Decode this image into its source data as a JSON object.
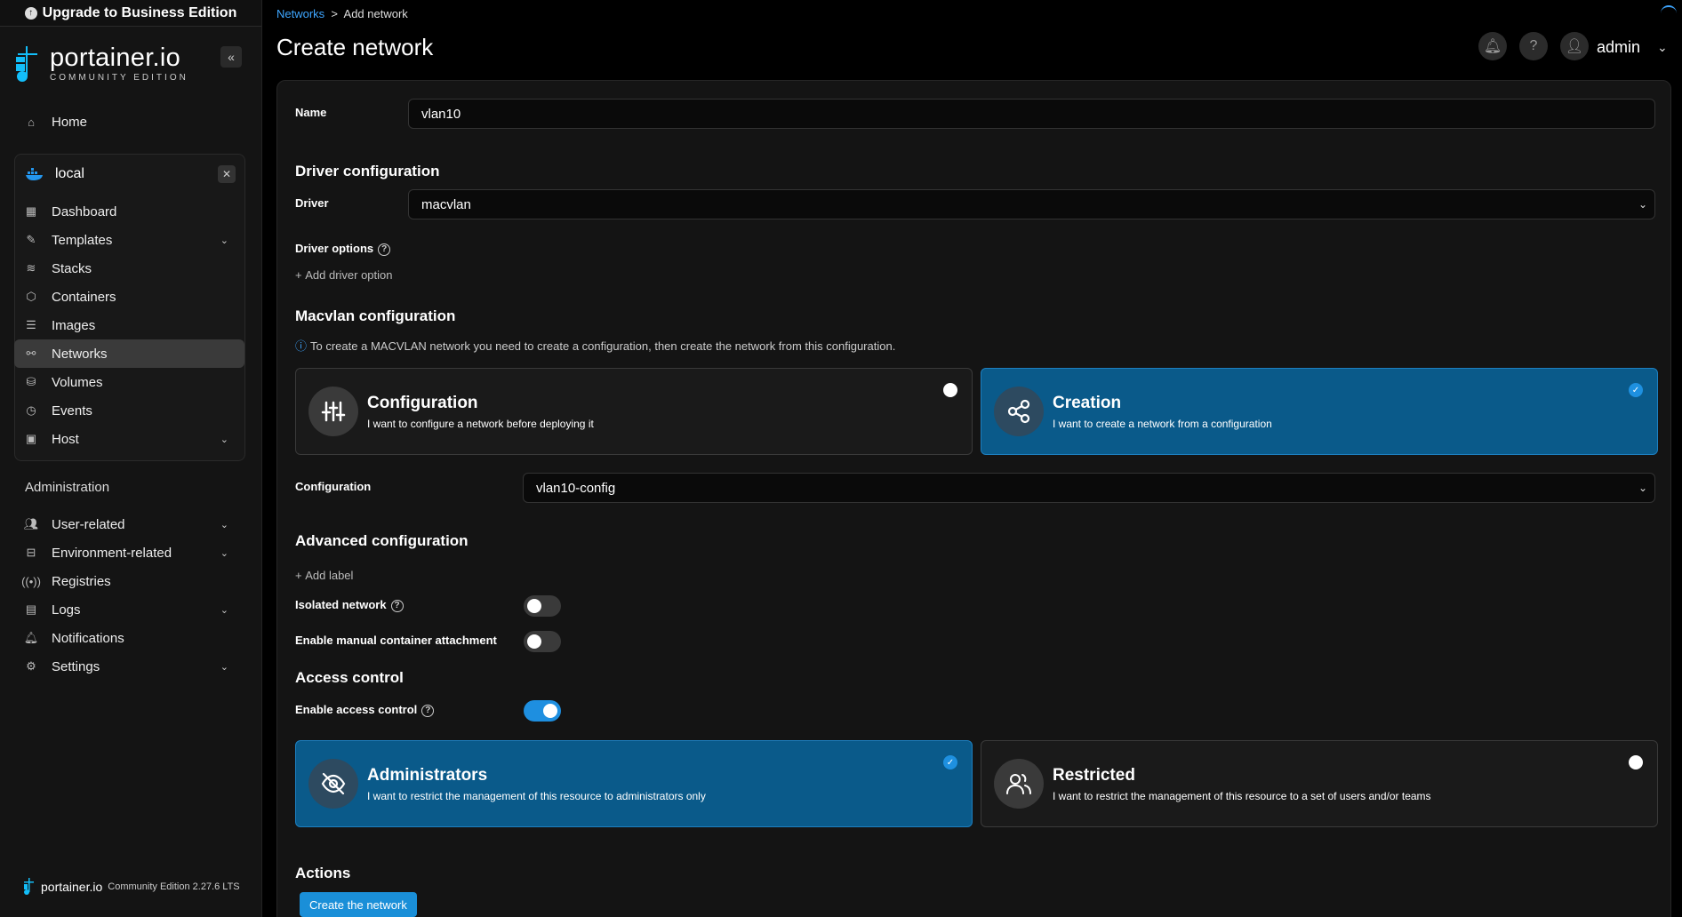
{
  "sidebar": {
    "upgrade_label": "Upgrade to Business Edition",
    "logo_brand": "portainer.io",
    "logo_edition": "COMMUNITY EDITION",
    "home": "Home",
    "environment": {
      "name": "local"
    },
    "env_items": [
      {
        "label": "Dashboard",
        "icon": "dashboard-icon"
      },
      {
        "label": "Templates",
        "icon": "templates-icon"
      },
      {
        "label": "Stacks",
        "icon": "stacks-icon"
      },
      {
        "label": "Containers",
        "icon": "containers-icon"
      },
      {
        "label": "Images",
        "icon": "images-icon"
      },
      {
        "label": "Networks",
        "icon": "networks-icon"
      },
      {
        "label": "Volumes",
        "icon": "volumes-icon"
      },
      {
        "label": "Events",
        "icon": "events-icon"
      },
      {
        "label": "Host",
        "icon": "host-icon"
      }
    ],
    "admin_title": "Administration",
    "admin_items": [
      {
        "label": "User-related"
      },
      {
        "label": "Environment-related"
      },
      {
        "label": "Registries"
      },
      {
        "label": "Logs"
      },
      {
        "label": "Notifications"
      },
      {
        "label": "Settings"
      }
    ],
    "footer_brand": "portainer.io",
    "footer_version": "Community Edition 2.27.6 LTS"
  },
  "header": {
    "breadcrumb_link": "Networks",
    "breadcrumb_sep": ">",
    "breadcrumb_current": "Add network",
    "title": "Create network",
    "user": "admin"
  },
  "form": {
    "name_label": "Name",
    "name_value": "vlan10",
    "driver_config_title": "Driver configuration",
    "driver_label": "Driver",
    "driver_value": "macvlan",
    "driver_options_label": "Driver options",
    "add_driver_option": "Add driver option",
    "macvlan_title": "Macvlan configuration",
    "macvlan_info": "To create a MACVLAN network you need to create a configuration, then create the network from this configuration.",
    "config_card_title": "Configuration",
    "config_card_desc": "I want to configure a network before deploying it",
    "creation_card_title": "Creation",
    "creation_card_desc": "I want to create a network from a configuration",
    "configuration_label": "Configuration",
    "configuration_value": "vlan10-config",
    "advanced_title": "Advanced configuration",
    "add_label": "Add label",
    "isolated_label": "Isolated network",
    "manual_attach_label": "Enable manual container attachment",
    "access_title": "Access control",
    "access_label": "Enable access control",
    "admins_title": "Administrators",
    "admins_desc": "I want to restrict the management of this resource to administrators only",
    "restricted_title": "Restricted",
    "restricted_desc": "I want to restrict the management of this resource to a set of users and/or teams",
    "actions_title": "Actions",
    "create_button": "Create the network"
  },
  "colors": {
    "accent": "#1a8fd8",
    "selected_card": "#0a5a8a",
    "link": "#3ea6ff"
  }
}
